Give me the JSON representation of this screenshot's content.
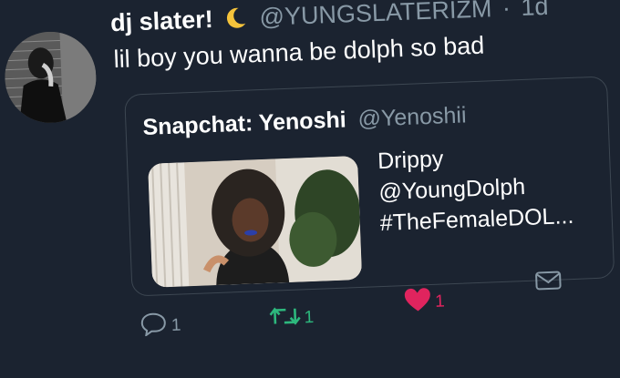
{
  "tweet": {
    "display_name": "dj slater!",
    "emoji": "crescent-moon",
    "handle": "@YUNGSLATERIZM",
    "separator": "·",
    "time": "1d",
    "text": "lil boy you wanna be dolph so bad"
  },
  "quote": {
    "name": "Snapchat: Yenoshi",
    "handle": "@Yenoshii",
    "lines": [
      "Drippy",
      "@YoungDolph",
      "#TheFemaleDOL..."
    ]
  },
  "actions": {
    "reply_count": "1",
    "retweet_count": "1",
    "like_count": "1"
  },
  "colors": {
    "background": "#1b2330",
    "retweet": "#2db87d",
    "like": "#e0245e",
    "muted": "#8899a6"
  }
}
